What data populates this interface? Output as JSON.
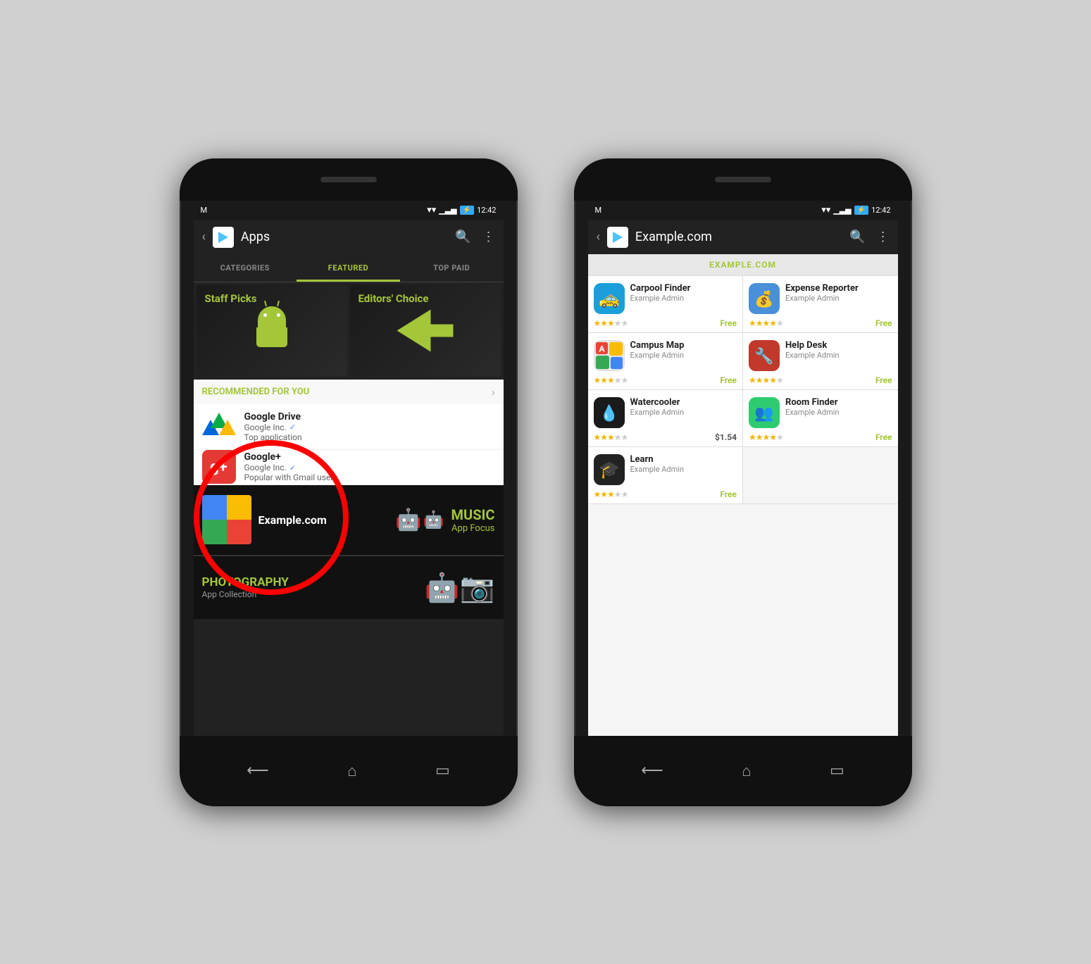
{
  "phone_left": {
    "status": {
      "carrier": "M",
      "time": "12:42"
    },
    "app_bar": {
      "title": "Apps",
      "back_label": "‹"
    },
    "tabs": [
      {
        "id": "categories",
        "label": "CATEGORIES",
        "active": false
      },
      {
        "id": "featured",
        "label": "FEATURED",
        "active": true
      },
      {
        "id": "top_paid",
        "label": "TOP PAID",
        "active": false
      }
    ],
    "banners": {
      "staff_picks": "Staff Picks",
      "editors_choice": "Editors' Choice"
    },
    "recommended": {
      "header": "RECOMMENDED FOR YOU",
      "items": [
        {
          "name": "Google Drive",
          "dev": "Google Inc.",
          "sub": "Top application"
        },
        {
          "name": "Google+",
          "dev": "Google Inc.",
          "sub": "Popular with Gmail users"
        }
      ]
    },
    "promos": [
      {
        "title": "Example.com",
        "type": "example"
      },
      {
        "title": "MUSIC",
        "sub": "App Focus",
        "type": "music"
      },
      {
        "title": "PHOTOGRAPHY",
        "sub": "App Collection",
        "type": "photography"
      }
    ]
  },
  "phone_right": {
    "status": {
      "carrier": "M",
      "time": "12:42"
    },
    "app_bar": {
      "title": "Example.com",
      "back_label": "‹"
    },
    "section_header": "EXAMPLE.COM",
    "apps": [
      {
        "name": "Carpool Finder",
        "dev": "Example Admin",
        "price": "Free",
        "stars": 3.5,
        "icon_type": "carpool"
      },
      {
        "name": "Expense Reporter",
        "dev": "Example Admin",
        "price": "Free",
        "stars": 4.0,
        "icon_type": "expense"
      },
      {
        "name": "Campus Map",
        "dev": "Example Admin",
        "price": "Free",
        "stars": 3.5,
        "icon_type": "map"
      },
      {
        "name": "Help Desk",
        "dev": "Example Admin",
        "price": "Free",
        "stars": 4.5,
        "icon_type": "helpdesk"
      },
      {
        "name": "Watercooler",
        "dev": "Example Admin",
        "price": "$1.54",
        "stars": 3.5,
        "icon_type": "watercooler"
      },
      {
        "name": "Room Finder",
        "dev": "Example Admin",
        "price": "Free",
        "stars": 4.5,
        "icon_type": "roomfinder"
      },
      {
        "name": "Learn",
        "dev": "Example Admin",
        "price": "Free",
        "stars": 3.5,
        "icon_type": "learn"
      }
    ]
  }
}
